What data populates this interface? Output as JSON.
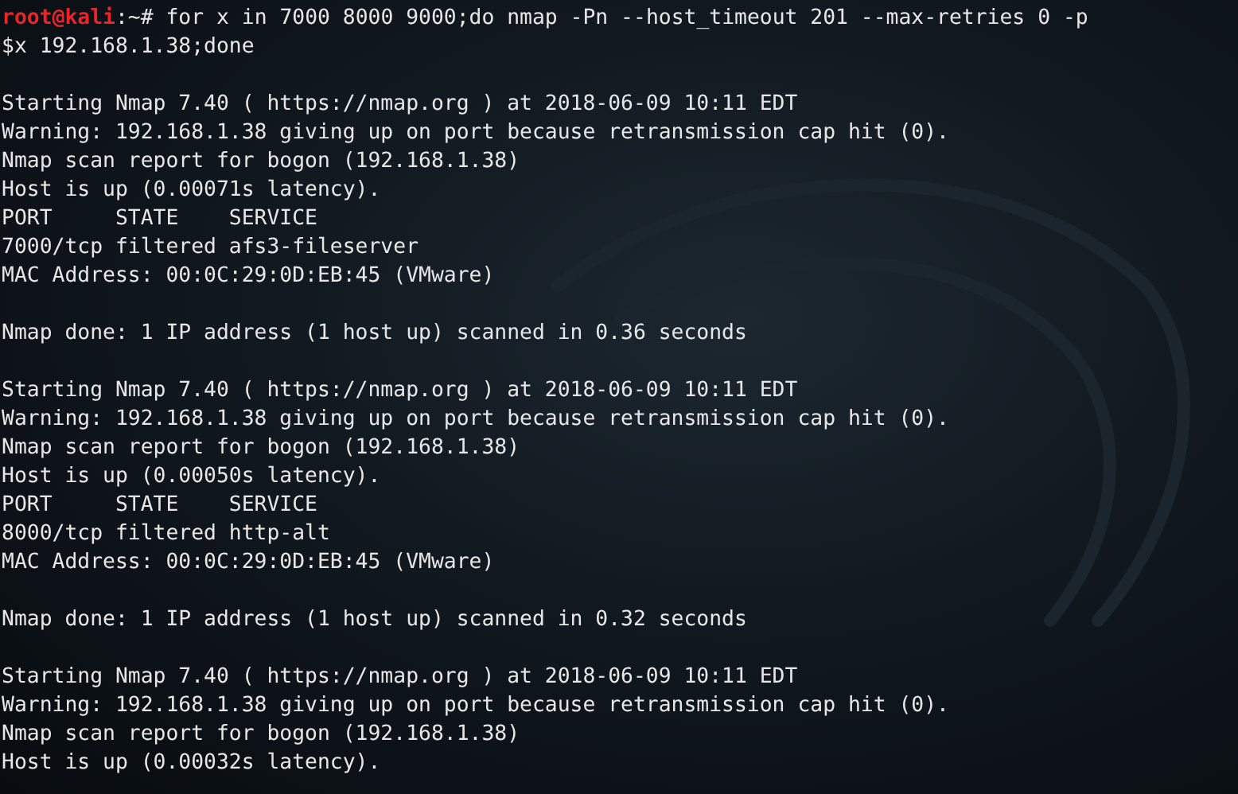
{
  "terminal": {
    "lines": [
      {
        "kind": "prompt",
        "user": "root@kali",
        "path": ":~#",
        "command": " for x in 7000 8000 9000;do nmap -Pn --host_timeout 201 --max-retries 0 -p"
      },
      {
        "kind": "output",
        "text": "$x 192.168.1.38;done"
      },
      {
        "kind": "blank"
      },
      {
        "kind": "output",
        "text": "Starting Nmap 7.40 ( https://nmap.org ) at 2018-06-09 10:11 EDT"
      },
      {
        "kind": "output",
        "text": "Warning: 192.168.1.38 giving up on port because retransmission cap hit (0)."
      },
      {
        "kind": "output",
        "text": "Nmap scan report for bogon (192.168.1.38)"
      },
      {
        "kind": "output",
        "text": "Host is up (0.00071s latency)."
      },
      {
        "kind": "output",
        "text": "PORT     STATE    SERVICE"
      },
      {
        "kind": "output",
        "text": "7000/tcp filtered afs3-fileserver"
      },
      {
        "kind": "output",
        "text": "MAC Address: 00:0C:29:0D:EB:45 (VMware)"
      },
      {
        "kind": "blank"
      },
      {
        "kind": "output",
        "text": "Nmap done: 1 IP address (1 host up) scanned in 0.36 seconds"
      },
      {
        "kind": "blank"
      },
      {
        "kind": "output",
        "text": "Starting Nmap 7.40 ( https://nmap.org ) at 2018-06-09 10:11 EDT"
      },
      {
        "kind": "output",
        "text": "Warning: 192.168.1.38 giving up on port because retransmission cap hit (0)."
      },
      {
        "kind": "output",
        "text": "Nmap scan report for bogon (192.168.1.38)"
      },
      {
        "kind": "output",
        "text": "Host is up (0.00050s latency)."
      },
      {
        "kind": "output",
        "text": "PORT     STATE    SERVICE"
      },
      {
        "kind": "output",
        "text": "8000/tcp filtered http-alt"
      },
      {
        "kind": "output",
        "text": "MAC Address: 00:0C:29:0D:EB:45 (VMware)"
      },
      {
        "kind": "blank"
      },
      {
        "kind": "output",
        "text": "Nmap done: 1 IP address (1 host up) scanned in 0.32 seconds"
      },
      {
        "kind": "blank"
      },
      {
        "kind": "output",
        "text": "Starting Nmap 7.40 ( https://nmap.org ) at 2018-06-09 10:11 EDT"
      },
      {
        "kind": "output",
        "text": "Warning: 192.168.1.38 giving up on port because retransmission cap hit (0)."
      },
      {
        "kind": "output",
        "text": "Nmap scan report for bogon (192.168.1.38)"
      },
      {
        "kind": "output",
        "text": "Host is up (0.00032s latency)."
      }
    ]
  }
}
